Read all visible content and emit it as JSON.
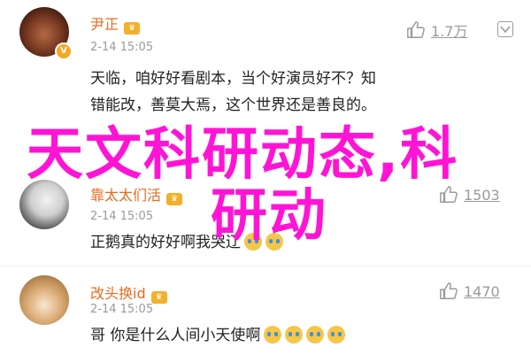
{
  "comments": [
    {
      "username": "尹正",
      "time": "2-14 15:05",
      "likes": "1.7万",
      "text_line1": "天临，咱好好看剧本，当个好演员好不？知",
      "text_line2": "错能改，善莫大焉，这个世界还是善良的。",
      "badge": "V"
    },
    {
      "username": "靠太太们活",
      "time": "2-14 15:05",
      "likes": "1503",
      "text": "正鹅真的好好啊我哭辽"
    },
    {
      "username": "改头换id",
      "time": "2-14 15:05",
      "likes": "1470",
      "text": "哥 你是什么人间小天使啊"
    }
  ],
  "overlay": {
    "line1": "天文科研动态,科",
    "line2": "研动",
    "color": "#ff14d5"
  },
  "colors": {
    "username": "#e86b1f",
    "vip": "#f3b02a",
    "meta": "#9a9a9a"
  }
}
